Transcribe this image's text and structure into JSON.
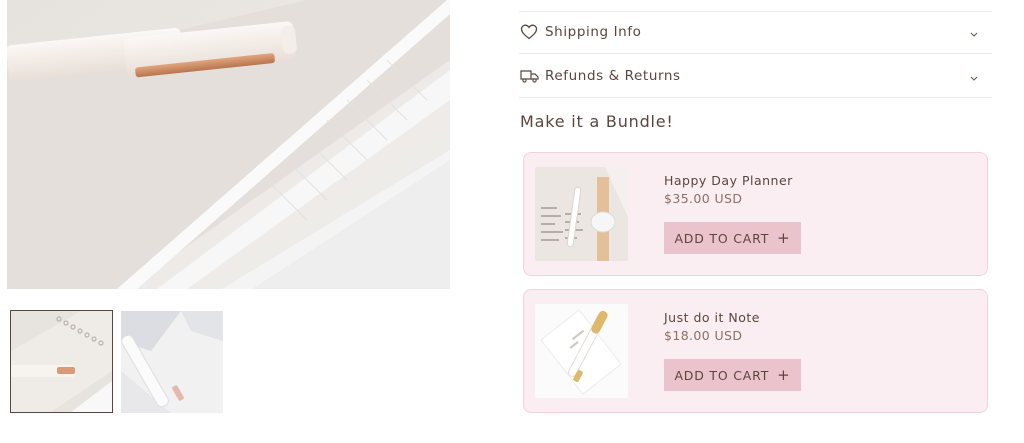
{
  "gallery": {
    "main_image": "pen-on-notebook-photo",
    "thumbnails": [
      "spiral-notebook-with-pen",
      "open-notebook-with-pen"
    ]
  },
  "accordion": [
    {
      "label": "Shipping Info",
      "icon": "heart-icon"
    },
    {
      "label": "Refunds & Returns",
      "icon": "truck-icon"
    }
  ],
  "bundle": {
    "title": "Make it a Bundle!",
    "items": [
      {
        "name": "Happy Day Planner",
        "price": "$35.00 USD",
        "button": "ADD TO CART",
        "button_icon": "+"
      },
      {
        "name": "Just do it Note",
        "price": "$18.00 USD",
        "button": "ADD TO CART",
        "button_icon": "+"
      }
    ]
  },
  "colors": {
    "card_background": "#fbeef2",
    "card_border": "#f2d3dc",
    "button": "#ebc3cc",
    "text": "#5b463e"
  }
}
